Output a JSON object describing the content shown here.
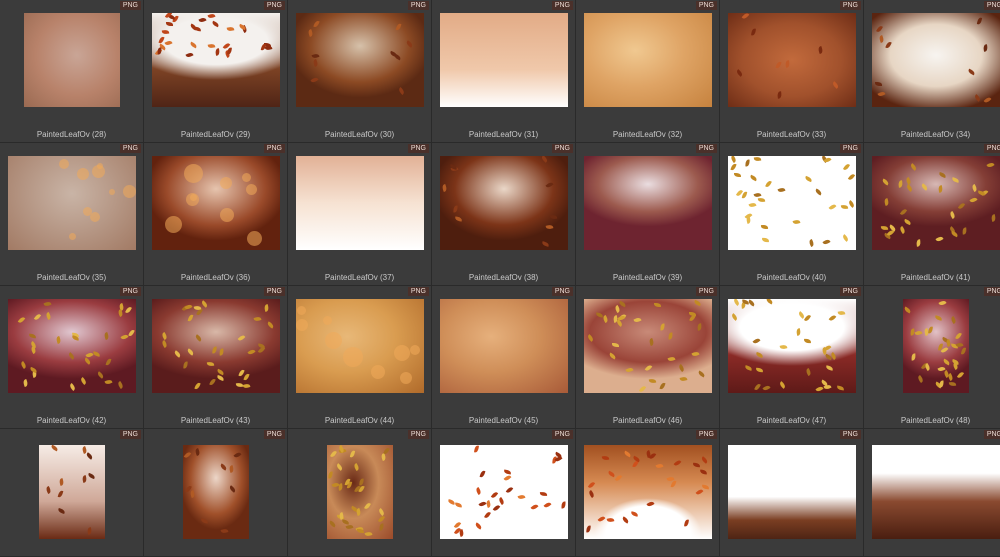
{
  "badge_label": "PNG",
  "thumbnails": [
    {
      "name": "PaintedLeafOv (28)",
      "variant": "square",
      "style": "soft-peach",
      "colors": [
        "#b8826a",
        "#c9a596",
        "#9a6a52"
      ],
      "leaves": "none"
    },
    {
      "name": "PaintedLeafOv (29)",
      "variant": "landscape",
      "style": "white-top",
      "colors": [
        "#f4f1ee",
        "#7c4224",
        "#4f2416"
      ],
      "leaves": "falling"
    },
    {
      "name": "PaintedLeafOv (30)",
      "variant": "landscape",
      "style": "glow-center",
      "colors": [
        "#d6c1aa",
        "#8c4a24",
        "#5c2a14"
      ],
      "leaves": "corners"
    },
    {
      "name": "PaintedLeafOv (31)",
      "variant": "landscape",
      "style": "white-bottom",
      "colors": [
        "#e2ab86",
        "#f0c8aa",
        "#ffffff"
      ],
      "leaves": "none"
    },
    {
      "name": "PaintedLeafOv (32)",
      "variant": "landscape",
      "style": "orange-mist",
      "colors": [
        "#dfa465",
        "#c6823e",
        "#f0c890"
      ],
      "leaves": "none"
    },
    {
      "name": "PaintedLeafOv (33)",
      "variant": "landscape",
      "style": "dark-rust",
      "colors": [
        "#a1512c",
        "#6e2d16",
        "#c26a3c"
      ],
      "leaves": "scattered"
    },
    {
      "name": "PaintedLeafOv (34)",
      "variant": "landscape",
      "style": "white-center",
      "colors": [
        "#f7f4f0",
        "#e7d6c4",
        "#5a2410"
      ],
      "leaves": "corners"
    },
    {
      "name": "PaintedLeafOv (35)",
      "variant": "landscape",
      "style": "bokeh",
      "colors": [
        "#c9b4a6",
        "#a27a64",
        "#e09650"
      ],
      "leaves": "bokeh"
    },
    {
      "name": "PaintedLeafOv (36)",
      "variant": "landscape",
      "style": "glow-center",
      "colors": [
        "#e6c4ae",
        "#9a4a2a",
        "#62220e"
      ],
      "leaves": "bokeh"
    },
    {
      "name": "PaintedLeafOv (37)",
      "variant": "landscape",
      "style": "light-peach",
      "colors": [
        "#f6e2d2",
        "#e2b196",
        "#ffffff"
      ],
      "leaves": "none"
    },
    {
      "name": "PaintedLeafOv (38)",
      "variant": "landscape",
      "style": "glow-center",
      "colors": [
        "#ead7c8",
        "#7c3418",
        "#4e1e0e"
      ],
      "leaves": "corners"
    },
    {
      "name": "PaintedLeafOv (39)",
      "variant": "landscape",
      "style": "mauve-fog",
      "colors": [
        "#eadde0",
        "#9c5a4e",
        "#6e2430"
      ],
      "leaves": "none"
    },
    {
      "name": "PaintedLeafOv (40)",
      "variant": "landscape",
      "style": "white-leaves",
      "colors": [
        "#ffffff",
        "#ffffff",
        "#ffffff"
      ],
      "leaves": "gold"
    },
    {
      "name": "PaintedLeafOv (41)",
      "variant": "landscape",
      "style": "mauve-fog",
      "colors": [
        "#d7b8b4",
        "#843e36",
        "#5e1e22"
      ],
      "leaves": "gold"
    },
    {
      "name": "PaintedLeafOv (42)",
      "variant": "landscape",
      "style": "berry-gold",
      "colors": [
        "#e0c7d0",
        "#9a3c40",
        "#5e1a22"
      ],
      "leaves": "gold"
    },
    {
      "name": "PaintedLeafOv (43)",
      "variant": "landscape",
      "style": "berry-gold",
      "colors": [
        "#d8b8a8",
        "#8a3a30",
        "#5a1c1c"
      ],
      "leaves": "gold"
    },
    {
      "name": "PaintedLeafOv (44)",
      "variant": "landscape",
      "style": "orange-mist",
      "colors": [
        "#d99c50",
        "#b06a2a",
        "#e8b878"
      ],
      "leaves": "bokeh"
    },
    {
      "name": "PaintedLeafOv (45)",
      "variant": "landscape",
      "style": "orange-mist",
      "colors": [
        "#cf8e58",
        "#a85a38",
        "#e6b07c"
      ],
      "leaves": "none"
    },
    {
      "name": "PaintedLeafOv (46)",
      "variant": "landscape",
      "style": "berry-gold",
      "colors": [
        "#c88a78",
        "#9a4438",
        "#dcae8e"
      ],
      "leaves": "gold"
    },
    {
      "name": "PaintedLeafOv (47)",
      "variant": "landscape",
      "style": "white-top",
      "colors": [
        "#ffffff",
        "#8a2a26",
        "#5e1a18"
      ],
      "leaves": "gold"
    },
    {
      "name": "PaintedLeafOv (48)",
      "variant": "portrait",
      "style": "berry-gold",
      "colors": [
        "#e2c2c6",
        "#9a3c40",
        "#5e1a22"
      ],
      "leaves": "gold"
    },
    {
      "name": "",
      "variant": "portrait",
      "style": "white-leaves-brown",
      "colors": [
        "#f6ece6",
        "#cfa898",
        "#6a2a14"
      ],
      "leaves": "corners"
    },
    {
      "name": "",
      "variant": "portrait",
      "style": "glow-center",
      "colors": [
        "#ecd6c8",
        "#a0502a",
        "#6a2a12"
      ],
      "leaves": "corners"
    },
    {
      "name": "",
      "variant": "portrait",
      "style": "orange-mist",
      "colors": [
        "#c88a58",
        "#9a4a2a",
        "#6a2a16"
      ],
      "leaves": "gold"
    },
    {
      "name": "",
      "variant": "landscape",
      "style": "white-leaves",
      "colors": [
        "#ffffff",
        "#ffffff",
        "#ffffff"
      ],
      "leaves": "orange"
    },
    {
      "name": "",
      "variant": "landscape",
      "style": "white-bottom-hill",
      "colors": [
        "#ffffff",
        "#d68a52",
        "#a25020"
      ],
      "leaves": "orange"
    },
    {
      "name": "",
      "variant": "landscape",
      "style": "white-bottom-dark",
      "colors": [
        "#ffffff",
        "#7a3e22",
        "#4e2414"
      ],
      "leaves": "none"
    },
    {
      "name": "",
      "variant": "landscape",
      "style": "white-top-dark",
      "colors": [
        "#ffffff",
        "#8a4a30",
        "#4a1e10"
      ],
      "leaves": "none"
    }
  ]
}
